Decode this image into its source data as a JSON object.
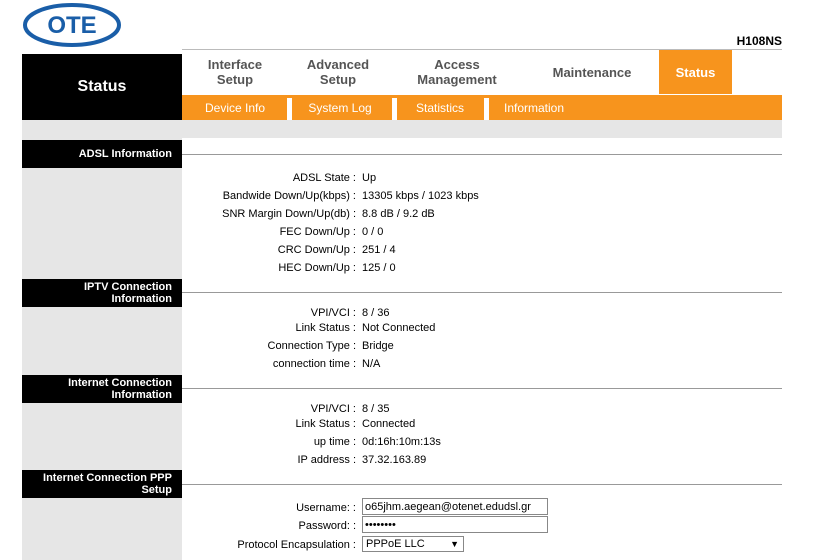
{
  "brand": {
    "logo_text": "OTE",
    "model": "H108NS",
    "logo_color": "#1a5ea8"
  },
  "colors": {
    "accent": "#f7941d"
  },
  "header": {
    "section_title": "Status"
  },
  "tabs": [
    {
      "line1": "Interface",
      "line2": "Setup"
    },
    {
      "line1": "Advanced",
      "line2": "Setup"
    },
    {
      "line1": "Access",
      "line2": "Management"
    },
    {
      "line1": "Maintenance",
      "line2": ""
    },
    {
      "line1": "Status",
      "line2": ""
    }
  ],
  "subtabs": [
    "Device Info",
    "System Log",
    "Statistics",
    "Information"
  ],
  "adsl": {
    "title": "ADSL Information",
    "rows": [
      {
        "label": "ADSL State :",
        "value": "Up"
      },
      {
        "label": "Bandwide Down/Up(kbps) :",
        "value": "13305 kbps / 1023 kbps"
      },
      {
        "label": "SNR Margin Down/Up(db) :",
        "value": "8.8 dB / 9.2 dB"
      },
      {
        "label": "FEC Down/Up :",
        "value": "0 / 0"
      },
      {
        "label": "CRC Down/Up :",
        "value": "251 / 4"
      },
      {
        "label": "HEC Down/Up :",
        "value": "125 / 0"
      }
    ]
  },
  "iptv": {
    "title_line1": "IPTV Connection",
    "title_line2": "Information",
    "rows": [
      {
        "label": "VPI/VCI :",
        "value": "8 / 36"
      },
      {
        "label": "Link Status :",
        "value": "Not Connected"
      },
      {
        "label": "Connection Type :",
        "value": "Bridge"
      },
      {
        "label": "connection time :",
        "value": "N/A"
      }
    ]
  },
  "internet": {
    "title_line1": "Internet Connection",
    "title_line2": "Information",
    "rows": [
      {
        "label": "VPI/VCI :",
        "value": "8 / 35"
      },
      {
        "label": "Link Status :",
        "value": "Connected"
      },
      {
        "label": "up time :",
        "value": "0d:16h:10m:13s"
      },
      {
        "label": "IP address :",
        "value": "37.32.163.89"
      }
    ]
  },
  "ppp": {
    "title_line1": "Internet Connection PPP",
    "title_line2": "Setup",
    "username_label": "Username: :",
    "username_value": "o65jhm.aegean@otenet.edudsl.gr",
    "password_label": "Password: :",
    "password_value": "••••••••",
    "encap_label": "Protocol Encapsulation :",
    "encap_value": "PPPoE LLC"
  }
}
